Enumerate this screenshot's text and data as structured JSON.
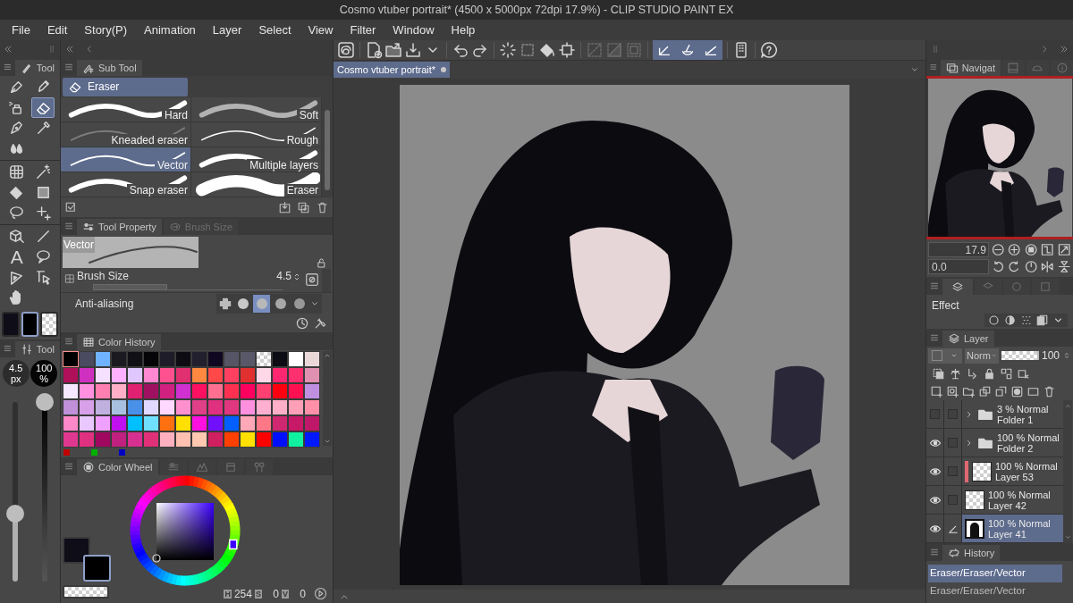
{
  "window": {
    "title": "Cosmo vtuber portrait* (4500 x 5000px 72dpi 17.9%) - CLIP STUDIO PAINT EX"
  },
  "menu": [
    "File",
    "Edit",
    "Story(P)",
    "Animation",
    "Layer",
    "Select",
    "View",
    "Filter",
    "Window",
    "Help"
  ],
  "tool_palette": {
    "tab": "Tool",
    "groups": [
      [
        {
          "kind": "pen",
          "selected": false
        },
        {
          "kind": "pencil",
          "selected": false
        },
        {
          "kind": "spray",
          "selected": false
        },
        {
          "kind": "eraser",
          "selected": true
        },
        {
          "kind": "nib",
          "selected": false
        },
        {
          "kind": "dropper",
          "selected": false
        },
        {
          "kind": "blend",
          "selected": false
        }
      ],
      [
        {
          "kind": "operation",
          "selected": false
        },
        {
          "kind": "wand",
          "selected": false
        },
        {
          "kind": "fill",
          "selected": false
        },
        {
          "kind": "gradient",
          "selected": false
        },
        {
          "kind": "lasso",
          "selected": false
        },
        {
          "kind": "sparkle",
          "selected": false
        }
      ],
      [
        {
          "kind": "cube",
          "selected": false
        },
        {
          "kind": "line",
          "selected": false
        },
        {
          "kind": "text",
          "label": "A",
          "selected": false
        },
        {
          "kind": "balloon",
          "selected": false
        },
        {
          "kind": "ruler",
          "selected": false
        },
        {
          "kind": "select",
          "selected": false
        },
        {
          "kind": "hand",
          "selected": false
        }
      ]
    ],
    "swatches": [
      {
        "kind": "color",
        "color": "#0e0d18",
        "selected": false
      },
      {
        "kind": "color",
        "color": "#000000",
        "selected": true
      },
      {
        "kind": "transparent",
        "selected": false
      }
    ]
  },
  "brush_panel": {
    "tab": "Tool",
    "size": "4.5",
    "size_unit": "px",
    "opacity": "100",
    "opacity_unit": "%",
    "size_slider": {
      "level": 0.38
    },
    "opacity_slider": {
      "level": 1
    }
  },
  "sub_tool": {
    "tab": "Sub Tool",
    "group": "Eraser",
    "items": [
      {
        "label": "Hard",
        "kind": "hard",
        "selected": false
      },
      {
        "label": "Soft",
        "kind": "soft",
        "selected": false
      },
      {
        "label": "Kneaded eraser",
        "kind": "kneaded",
        "selected": false
      },
      {
        "label": "Rough",
        "kind": "rough",
        "selected": false
      },
      {
        "label": "Vector",
        "kind": "vector",
        "selected": true
      },
      {
        "label": "Multiple layers",
        "kind": "multiple",
        "selected": false
      },
      {
        "label": "Snap eraser",
        "kind": "snap",
        "selected": false
      },
      {
        "label": "Eraser",
        "kind": "block",
        "selected": false
      }
    ]
  },
  "tool_property": {
    "tabs": [
      {
        "label": "Tool Property",
        "selected": true
      },
      {
        "label": "Brush Size",
        "selected": false
      }
    ],
    "preview_label": "Vector",
    "brush_size": {
      "label": "Brush Size",
      "value": "4.5",
      "level": 0.39
    },
    "anti_aliasing": {
      "label": "Anti-aliasing",
      "options": [
        {
          "selected": false
        },
        {
          "selected": true
        },
        {
          "selected": false
        },
        {
          "selected": false
        }
      ]
    }
  },
  "color_history": {
    "tab": "Color History",
    "colors": [
      {
        "kind": "color",
        "color": "#000000",
        "selected": true
      },
      {
        "kind": "color",
        "color": "#4a4a60",
        "selected": false
      },
      {
        "kind": "color",
        "color": "#6fb2ff",
        "selected": false
      },
      {
        "kind": "color",
        "color": "#1a1a20",
        "selected": false
      },
      {
        "kind": "color",
        "color": "#101015",
        "selected": false
      },
      {
        "kind": "color",
        "color": "#050508",
        "selected": false
      },
      {
        "kind": "color",
        "color": "#1e1c28",
        "selected": false
      },
      {
        "kind": "color",
        "color": "#0c0c12",
        "selected": false
      },
      {
        "kind": "color",
        "color": "#22202e",
        "selected": false
      },
      {
        "kind": "color",
        "color": "#100820",
        "selected": false
      },
      {
        "kind": "color",
        "color": "#555566",
        "selected": false
      },
      {
        "kind": "color",
        "color": "#585868",
        "selected": false
      },
      {
        "kind": "transparent",
        "selected": false
      },
      {
        "kind": "color",
        "color": "#0c0c14",
        "selected": false
      },
      {
        "kind": "color",
        "color": "#ffffff",
        "selected": false
      },
      {
        "kind": "color",
        "color": "#ead8d8",
        "selected": false
      },
      {
        "kind": "color",
        "color": "#b0105a",
        "selected": false
      },
      {
        "kind": "color",
        "color": "#d030c0",
        "selected": false
      },
      {
        "kind": "color",
        "color": "#f5e0ff",
        "selected": false
      },
      {
        "kind": "color",
        "color": "#ffb0ff",
        "selected": false
      },
      {
        "kind": "color",
        "color": "#e0c8ff",
        "selected": false
      },
      {
        "kind": "color",
        "color": "#ff88d0",
        "selected": false
      },
      {
        "kind": "color",
        "color": "#ff5090",
        "selected": false
      },
      {
        "kind": "color",
        "color": "#e03070",
        "selected": false
      },
      {
        "kind": "color",
        "color": "#ff8840",
        "selected": false
      },
      {
        "kind": "color",
        "color": "#ff4848",
        "selected": false
      },
      {
        "kind": "color",
        "color": "#ff4060",
        "selected": false
      },
      {
        "kind": "color",
        "color": "#e03030",
        "selected": false
      },
      {
        "kind": "color",
        "color": "#ffd8e8",
        "selected": false
      },
      {
        "kind": "color",
        "color": "#ff2870",
        "selected": false
      },
      {
        "kind": "color",
        "color": "#ff3070",
        "selected": false
      },
      {
        "kind": "color",
        "color": "#e090b0",
        "selected": false
      },
      {
        "kind": "color",
        "color": "#f5e8ff",
        "selected": false
      },
      {
        "kind": "color",
        "color": "#ff90e0",
        "selected": false
      },
      {
        "kind": "color",
        "color": "#ff80b0",
        "selected": false
      },
      {
        "kind": "color",
        "color": "#ffb0c8",
        "selected": false
      },
      {
        "kind": "color",
        "color": "#e02070",
        "selected": false
      },
      {
        "kind": "color",
        "color": "#a01060",
        "selected": false
      },
      {
        "kind": "color",
        "color": "#d02080",
        "selected": false
      },
      {
        "kind": "color",
        "color": "#d030d0",
        "selected": false
      },
      {
        "kind": "color",
        "color": "#ff1060",
        "selected": false
      },
      {
        "kind": "color",
        "color": "#ff7090",
        "selected": false
      },
      {
        "kind": "color",
        "color": "#ff3050",
        "selected": false
      },
      {
        "kind": "color",
        "color": "#ff0060",
        "selected": false
      },
      {
        "kind": "color",
        "color": "#ff4070",
        "selected": false
      },
      {
        "kind": "color",
        "color": "#ff0010",
        "selected": false
      },
      {
        "kind": "color",
        "color": "#ff1050",
        "selected": false
      },
      {
        "kind": "color",
        "color": "#c090e0",
        "selected": false
      },
      {
        "kind": "color",
        "color": "#c090d8",
        "selected": false
      },
      {
        "kind": "color",
        "color": "#d8a0e8",
        "selected": false
      },
      {
        "kind": "color",
        "color": "#c0b0e0",
        "selected": false
      },
      {
        "kind": "color",
        "color": "#a8c0e0",
        "selected": false
      },
      {
        "kind": "color",
        "color": "#4890e8",
        "selected": false
      },
      {
        "kind": "color",
        "color": "#e0d8ff",
        "selected": false
      },
      {
        "kind": "color",
        "color": "#ffd8ff",
        "selected": false
      },
      {
        "kind": "color",
        "color": "#ff90d0",
        "selected": false
      },
      {
        "kind": "color",
        "color": "#e04088",
        "selected": false
      },
      {
        "kind": "color",
        "color": "#e03080",
        "selected": false
      },
      {
        "kind": "color",
        "color": "#e03880",
        "selected": false
      },
      {
        "kind": "color",
        "color": "#ff90e0",
        "selected": false
      },
      {
        "kind": "color",
        "color": "#ffb0d0",
        "selected": false
      },
      {
        "kind": "color",
        "color": "#ffb0c8",
        "selected": false
      },
      {
        "kind": "color",
        "color": "#ffa0b8",
        "selected": false
      },
      {
        "kind": "color",
        "color": "#ff90a8",
        "selected": false
      },
      {
        "kind": "color",
        "color": "#ff88c8",
        "selected": false
      },
      {
        "kind": "color",
        "color": "#e8c8ff",
        "selected": false
      },
      {
        "kind": "color",
        "color": "#f0a0ff",
        "selected": false
      },
      {
        "kind": "color",
        "color": "#c010f0",
        "selected": false
      },
      {
        "kind": "color",
        "color": "#00c0ff",
        "selected": false
      },
      {
        "kind": "color",
        "color": "#70e0ff",
        "selected": false
      },
      {
        "kind": "color",
        "color": "#ff7010",
        "selected": false
      },
      {
        "kind": "color",
        "color": "#ffe000",
        "selected": false
      },
      {
        "kind": "color",
        "color": "#ff10e0",
        "selected": false
      },
      {
        "kind": "color",
        "color": "#7010ff",
        "selected": false
      },
      {
        "kind": "color",
        "color": "#0060ff",
        "selected": false
      },
      {
        "kind": "color",
        "color": "#ffa8b8",
        "selected": false
      },
      {
        "kind": "color",
        "color": "#ff7888",
        "selected": false
      },
      {
        "kind": "color",
        "color": "#d02870",
        "selected": false
      },
      {
        "kind": "color",
        "color": "#c81868",
        "selected": false
      },
      {
        "kind": "color",
        "color": "#c01868",
        "selected": false
      },
      {
        "kind": "color",
        "color": "#e03890",
        "selected": false
      },
      {
        "kind": "color",
        "color": "#e03080",
        "selected": false
      },
      {
        "kind": "color",
        "color": "#a00860",
        "selected": false
      },
      {
        "kind": "color",
        "color": "#c02080",
        "selected": false
      },
      {
        "kind": "color",
        "color": "#d83090",
        "selected": false
      },
      {
        "kind": "color",
        "color": "#e03078",
        "selected": false
      },
      {
        "kind": "color",
        "color": "#ffb0c0",
        "selected": false
      },
      {
        "kind": "color",
        "color": "#ffc0b0",
        "selected": false
      },
      {
        "kind": "color",
        "color": "#ffc8b0",
        "selected": false
      },
      {
        "kind": "color",
        "color": "#d02060",
        "selected": false
      },
      {
        "kind": "color",
        "color": "#ff4000",
        "selected": false
      },
      {
        "kind": "color",
        "color": "#ffe000",
        "selected": false
      },
      {
        "kind": "color",
        "color": "#ff0000",
        "selected": false
      },
      {
        "kind": "color",
        "color": "#0010ff",
        "selected": false
      },
      {
        "kind": "color",
        "color": "#10f0a0",
        "selected": false
      },
      {
        "kind": "color",
        "color": "#0018ff",
        "selected": false
      }
    ]
  },
  "color_wheel": {
    "tab": "Color Wheel",
    "h_label": "H",
    "h": "254",
    "s_label": "S",
    "s": "0",
    "v_label": "V",
    "v": "0"
  },
  "canvas": {
    "doc_tab": "Cosmo vtuber portrait*",
    "snap_toggles": [
      {
        "on": true
      },
      {
        "on": true
      },
      {
        "on": true
      }
    ]
  },
  "navigator": {
    "tab": "Navigat",
    "zoom": "17.9",
    "angle": "0.0"
  },
  "effect": {
    "label": "Effect"
  },
  "layers": {
    "tab": "Layer",
    "blend_mode": "Norm",
    "opacity": "100",
    "opacity_slider": {
      "level": 1
    },
    "items": [
      {
        "mode": "3 % Normal",
        "name": "Folder 1",
        "kind": "folder",
        "visible": false,
        "editing": false,
        "selected": false
      },
      {
        "mode": "100 % Normal",
        "name": "Folder 2",
        "kind": "folder",
        "visible": true,
        "editing": false,
        "selected": false
      },
      {
        "mode": "100 % Normal",
        "name": "Layer 53",
        "kind": "empty",
        "color": "#e06870",
        "visible": true,
        "editing": false,
        "selected": false
      },
      {
        "mode": "100 % Normal",
        "name": "Layer 42",
        "kind": "empty",
        "visible": true,
        "editing": false,
        "selected": false
      },
      {
        "mode": "100 % Normal",
        "name": "Layer 41",
        "kind": "drawn",
        "visible": true,
        "editing": true,
        "selected": true
      }
    ]
  },
  "history": {
    "tab": "History",
    "items": [
      {
        "label": "Eraser/Eraser/Vector",
        "selected": true
      },
      {
        "label": "Eraser/Eraser/Vector",
        "selected": false
      }
    ]
  }
}
